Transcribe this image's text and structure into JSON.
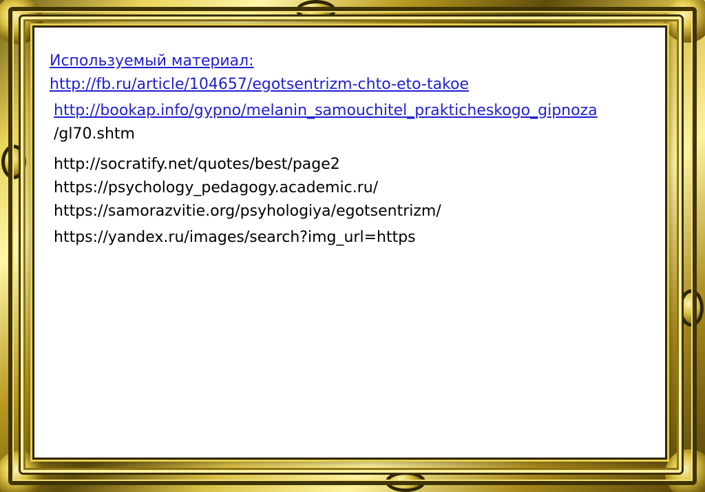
{
  "slide": {
    "heading": "Используемый материал:",
    "sources": [
      {
        "text": "http://fb.ru/article/104657/egotsentrizm-chto-eto-takoe",
        "link": true
      },
      {
        "text": "http://bookap.info/gypno/melanin_samouchitel_prakticheskogo_gipnoza",
        "link": true
      },
      {
        "text": "/gl70.shtm",
        "link": false
      },
      {
        "text": "http://socratify.net/quotes/best/page2",
        "link": false
      },
      {
        "text": "https://psychology_pedagogy.academic.ru/",
        "link": false
      },
      {
        "text": "https://samorazvitie.org/psyhologiya/egotsentrizm/",
        "link": false
      },
      {
        "text": "https://yandex.ru/images/search?img_url=https",
        "link": false
      }
    ]
  },
  "colors": {
    "frame_gold": "#d9c046",
    "frame_dark": "#3e3206",
    "link": "#1f1fd2",
    "text": "#000000",
    "background": "#ffffff"
  }
}
